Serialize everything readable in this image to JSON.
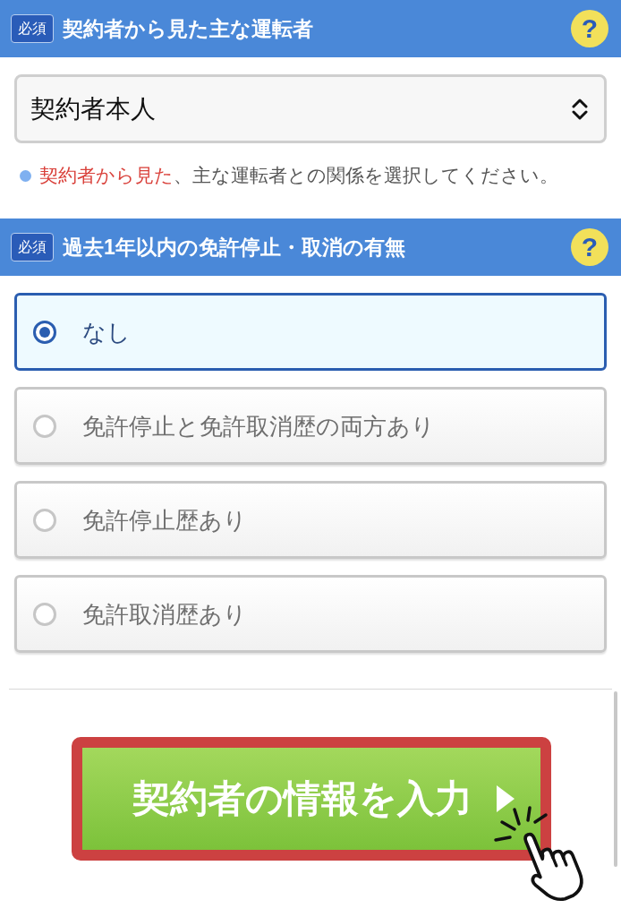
{
  "sections": [
    {
      "kind": "select",
      "badge": "必須",
      "title": "契約者から見た主な運転者",
      "help": "?",
      "select": {
        "value": "契約者本人"
      },
      "note": {
        "highlight": "契約者から見た",
        "text": "、主な運転者との関係を選択してください。"
      }
    },
    {
      "kind": "radio",
      "badge": "必須",
      "title": "過去1年以内の免許停止・取消の有無",
      "help": "?",
      "options": [
        {
          "label": "なし",
          "selected": true
        },
        {
          "label": "免許停止と免許取消歴の両方あり",
          "selected": false
        },
        {
          "label": "免許停止歴あり",
          "selected": false
        },
        {
          "label": "免許取消歴あり",
          "selected": false
        }
      ]
    }
  ],
  "next_button": {
    "label": "契約者の情報を入力"
  }
}
